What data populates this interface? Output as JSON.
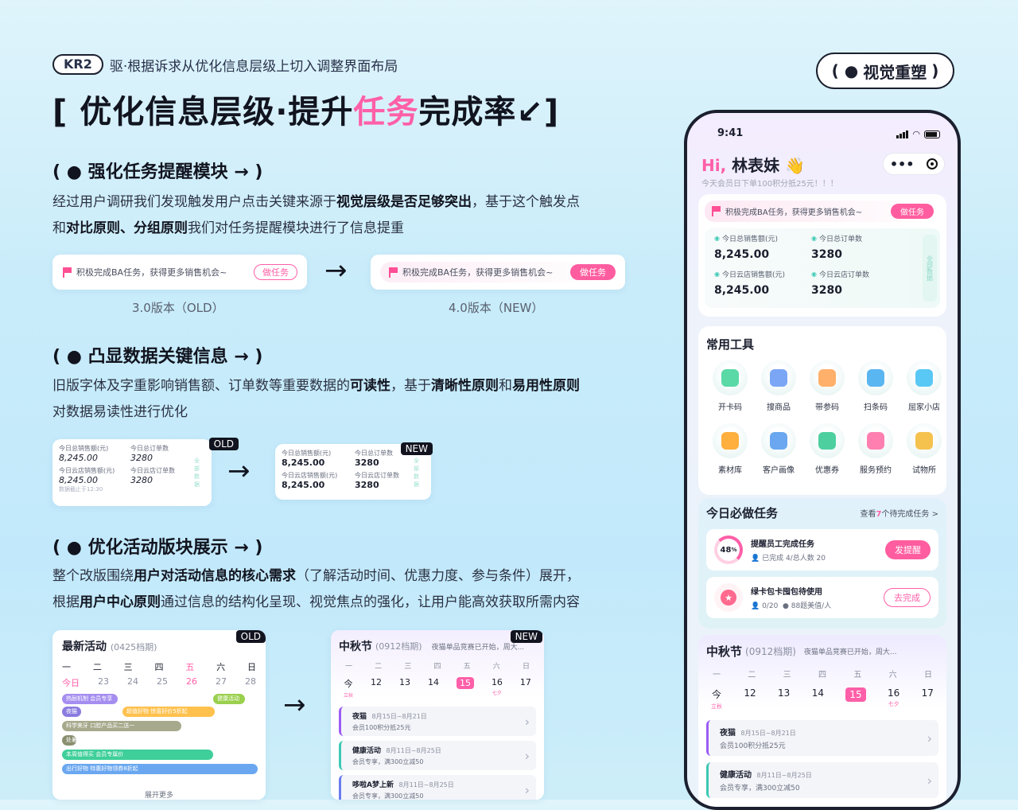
{
  "header": {
    "kr": "KR2",
    "kr_text": "驱·根据诉求从优化信息层级上切入调整界面布局",
    "title_pre": "[ 优化信息层级·提升",
    "title_hl": "任务",
    "title_post": "完成率↙]",
    "tag": "视觉重塑"
  },
  "sections": [
    {
      "head": "( ● 强化任务提醒模块 → )",
      "line1_a": "经过用户调研我们发现触发用户点击关键来源于",
      "line1_b": "视觉层级是否足够突出",
      "line1_c": "，基于这个触发点",
      "line2_a": "和",
      "line2_b": "对比原则、分组原则",
      "line2_c": "我们对任务提醒模块进行了信息提重"
    },
    {
      "head": "( ● 凸显数据关键信息 → )",
      "line1_a": "旧版字体及字重影响销售额、订单数等重要数据的",
      "line1_b": "可读性",
      "line1_c": "，基于",
      "line1_d": "清晰性原则",
      "line1_e": "和",
      "line1_f": "易用性原则",
      "line2": "对数据易读性进行优化"
    },
    {
      "head": "( ● 优化活动版块展示 → )",
      "line1_a": "整个改版围绕",
      "line1_b": "用户对活动信息的核心需求",
      "line1_c": "（了解活动时间、优惠力度、参与条件）展开，",
      "line2_a": "根据",
      "line2_b": "用户中心原则",
      "line2_c": "通过信息的结构化呈现、视觉焦点的强化，让用户能高效获取所需内容"
    }
  ],
  "compare1": {
    "text": "积极完成BA任务，获得更多销售机会~",
    "btn": "做任务",
    "old_caption": "3.0版本（OLD）",
    "new_caption": "4.0版本（NEW）"
  },
  "compare2": {
    "old_tag": "OLD",
    "new_tag": "NEW",
    "l1": "今日总销售额(元)",
    "v1": "8,245.00",
    "l2": "今日总订单数",
    "v2": "3280",
    "l3": "今日云店销售额(元)",
    "v3": "8,245.00",
    "l4": "今日云店订单数",
    "v4": "3280",
    "side": "全部数据",
    "foot": "数据截止于12:30"
  },
  "compare3": {
    "old_tag": "OLD",
    "new_tag": "NEW",
    "old_title": "最新活动",
    "old_sub": "(0425档期)",
    "weekdays": [
      "一",
      "二",
      "三",
      "四",
      "五",
      "六",
      "日"
    ],
    "old_days": [
      "今日",
      "23",
      "24",
      "25",
      "26",
      "27",
      "28"
    ],
    "old_bars": [
      "热耐机制 会员专享",
      "健康活动",
      "夜猫",
      "超值好物 惊喜好价5折起",
      "科学美牙 口腔产品买二送一",
      "处暑",
      "本周值得买 会员专属价",
      "出行好物 特惠好物领券8折起"
    ],
    "old_more": "展开更多",
    "new_title": "中秋节",
    "new_sub": "(0912档期)",
    "new_notice": "夜猫单品竞赛已开始，周大...",
    "new_days": [
      "今",
      "12",
      "13",
      "14",
      "15",
      "16",
      "17"
    ],
    "new_day_notes": [
      "立秋",
      "",
      "",
      "",
      "",
      "七夕",
      ""
    ],
    "acts": [
      {
        "title": "夜猫",
        "date": "8月15日~8月21日",
        "sub": "会员100积分抵25元"
      },
      {
        "title": "健康活动",
        "date": "8月11日~8月25日",
        "sub": "会员专享，满300立减50"
      },
      {
        "title": "哆啦A梦上新",
        "date": "8月11日~8月25日",
        "sub": "会员专享，满300立减50"
      }
    ]
  },
  "phone": {
    "time": "9:41",
    "greet_hi": "Hi,",
    "greet_name": "林表妹",
    "greet_wave": "👋",
    "greet_sub": "今天会员日下单100积分抵25元！！！",
    "remind": "积极完成BA任务，获得更多销售机会~",
    "remind_btn": "做任务",
    "stats": [
      {
        "label": "今日总销售额(元)",
        "value": "8,245.00"
      },
      {
        "label": "今日总订单数",
        "value": "3280"
      },
      {
        "label": "今日云店销售额(元)",
        "value": "8,245.00"
      },
      {
        "label": "今日云店订单数",
        "value": "3280"
      }
    ],
    "stats_side": "全部数据",
    "tools_title": "常用工具",
    "tools": [
      "开卡码",
      "搜商品",
      "带参码",
      "扫条码",
      "屈家小店",
      "素材库",
      "客户画像",
      "优惠券",
      "服务预约",
      "试物所"
    ],
    "tasks_title": "今日必做任务",
    "tasks_more_a": "查看",
    "tasks_more_n": "7",
    "tasks_more_b": "个待完成任务 >",
    "task1_pct": "48",
    "task1_pct_sign": "%",
    "task1_title": "提醒员工完成任务",
    "task1_sub": "已完成 4/总人数 20",
    "task1_btn": "发提醒",
    "task2_title": "绿卡包卡囤包待使用",
    "task2_sub_a": "0/20",
    "task2_sub_b": "88题美值/人",
    "task2_btn": "去完成",
    "fest_title": "中秋节",
    "fest_sub": "(0912档期)",
    "fest_notice": "夜猫单品竞赛已开始，周大...",
    "acts": [
      {
        "title": "夜猫",
        "date": "8月15日~8月21日",
        "sub": "会员100积分抵25元"
      },
      {
        "title": "健康活动",
        "date": "8月11日~8月25日",
        "sub": "会员专享，满300立减50"
      }
    ]
  },
  "colors": {
    "accent": "#ff5fa8",
    "teal": "#3cc9b4",
    "purple": "#9b5cf5",
    "ink": "#11141f"
  }
}
